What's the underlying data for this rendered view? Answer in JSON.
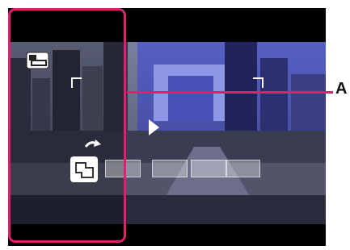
{
  "callout": {
    "label": "A"
  },
  "overlay": {
    "mode_icon": "sweep-panorama-mode-icon",
    "pano_icon": "panorama-direction-icon",
    "direction": "right"
  },
  "colors": {
    "highlight": "#e21f6f",
    "sky_left": "#8b8fae",
    "sky_right": "#4a52b8",
    "city": "#3a3f5c"
  }
}
